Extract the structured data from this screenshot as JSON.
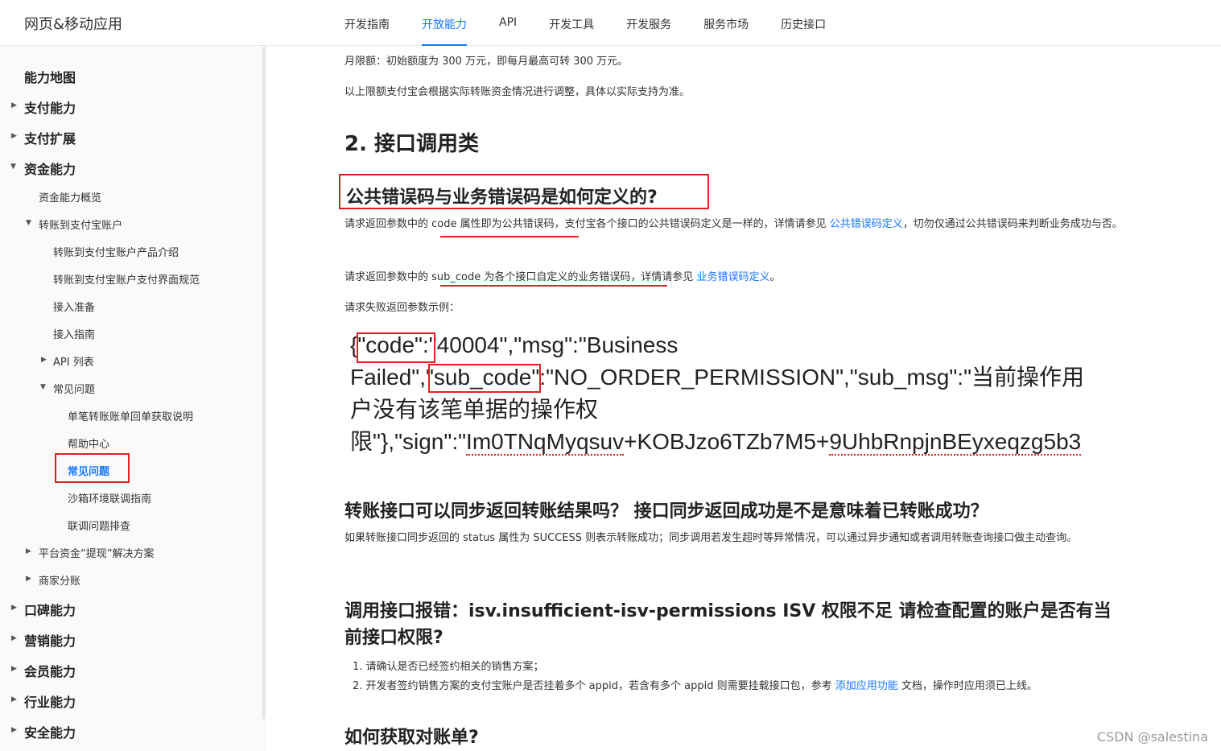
{
  "header": {
    "brand": "网页&移动应用",
    "nav": [
      "开发指南",
      "开放能力",
      "API",
      "开发工具",
      "开发服务",
      "服务市场",
      "历史接口"
    ]
  },
  "sidebar": {
    "map": "能力地图",
    "pay": "支付能力",
    "pay_ext": "支付扩展",
    "funds": "资金能力",
    "funds_overview": "资金能力概览",
    "transfer": "转账到支付宝账户",
    "transfer_intro": "转账到支付宝账户产品介绍",
    "transfer_ui": "转账到支付宝账户支付界面规范",
    "prepare": "接入准备",
    "guide": "接入指南",
    "api_list": "API 列表",
    "faq_group": "常见问题",
    "single_bill": "单笔转账账单回单获取说明",
    "help": "帮助中心",
    "faq_active": "常见问题",
    "sandbox": "沙箱环境联调指南",
    "debug": "联调问题排查",
    "withdraw": "平台资金“提现”解决方案",
    "split": "商家分账",
    "koubei": "口碑能力",
    "marketing": "营销能力",
    "member": "会员能力",
    "industry": "行业能力",
    "security": "安全能力"
  },
  "content": {
    "limit_month": "月限额：初始额度为 300 万元，即每月最高可转 300 万元。",
    "limit_note": "以上限额支付宝会根据实际转账资金情况进行调整，具体以实际支持为准。",
    "section2": "2. 接口调用类",
    "q1": "公共错误码与业务错误码是如何定义的?",
    "q1_p1_a": "请求返回参数中的 code 属性即为公共错误码，支付宝各个接口的公共错误码定义是一样的，详情请参见 ",
    "q1_p1_link": "公共错误码定义",
    "q1_p1_b": "，切勿仅通过公共错误码来判断业务成功与否。",
    "q1_p2_a": "请求返回参数中的 sub_code 为各个接口自定义的业务错误码，详情请参见 ",
    "q1_p2_link": "业务错误码定义",
    "q1_p2_b": "。",
    "q1_p3": "请求失败返回参数示例：",
    "code": {
      "l1_a": "{",
      "l1_key": "\"code\"",
      "l1_b": ":\"40004\",\"msg\":\"Business",
      "l2_a": "Failed\",",
      "l2_key": "\"sub_code\"",
      "l2_b": ":\"NO_ORDER_PERMISSION\",\"sub_msg\":\"当前操作用",
      "l3": "户没有该笔单据的操作权",
      "l4_a": "限\"},\"sign\":\"",
      "l4_s1": "Im0TNqMyqsuv",
      "l4_b": "+KOBJzo6TZb7M5+",
      "l4_s2": "9UhbRnpjnBEyxeqzg5b3"
    },
    "q2": "转账接口可以同步返回转账结果吗？ 接口同步返回成功是不是意味着已转账成功？",
    "q2_p": "如果转账接口同步返回的 status 属性为 SUCCESS 则表示转账成功；同步调用若发生超时等异常情况，可以通过异步通知或者调用转账查询接口做主动查询。",
    "q3_l1": "调用接口报错：isv.insufficient-isv-permissions ISV 权限不足 请检查配置的账户是否有当",
    "q3_l2": "前接口权限?",
    "q3_item1": "1. 请确认是否已经签约相关的销售方案；",
    "q3_item2_a": "2. 开发者签约销售方案的支付宝账户是否挂着多个 appid，若含有多个 appid 则需要挂载接口包，参考 ",
    "q3_item2_link": "添加应用功能",
    "q3_item2_b": " 文档，操作时应用须已上线。",
    "q4": "如何获取对账单?"
  },
  "watermark": "CSDN @salestina"
}
